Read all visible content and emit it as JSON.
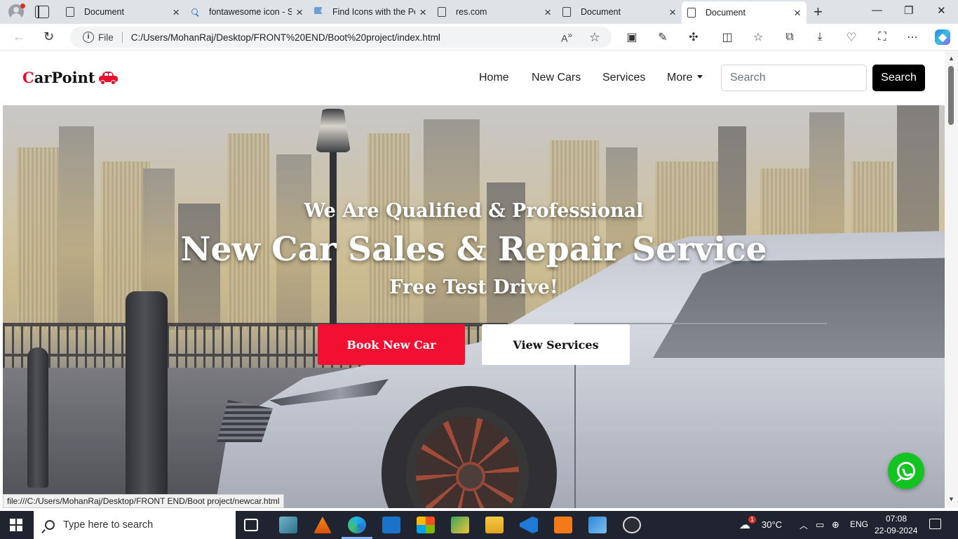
{
  "browser": {
    "tabs": [
      {
        "label": "Document",
        "icon": "page-icon"
      },
      {
        "label": "fontawesome icon - S",
        "icon": "search-icon"
      },
      {
        "label": "Find Icons with the Pe",
        "icon": "flag-icon"
      },
      {
        "label": "res.com",
        "icon": "page-icon"
      },
      {
        "label": "Document",
        "icon": "page-icon"
      },
      {
        "label": "Document",
        "icon": "page-icon",
        "active": true
      }
    ],
    "new_tab": "+",
    "minimize": "—",
    "restore": "❐",
    "close": "✕",
    "address": {
      "scheme_label": "File",
      "url": "C:/Users/MohanRaj/Desktop/FRONT%20END/Boot%20project/index.html"
    },
    "status_url": "file:///C:/Users/MohanRaj/Desktop/FRONT END/Boot project/newcar.html"
  },
  "site": {
    "brand": {
      "first": "C",
      "rest": "arPoint"
    },
    "nav": {
      "home": "Home",
      "new_cars": "New Cars",
      "services": "Services",
      "more": "More"
    },
    "search": {
      "placeholder": "Search",
      "button": "Search"
    },
    "hero": {
      "tagline": "We Are Qualified & Professional",
      "headline": "New Car Sales & Repair Service",
      "subline": "Free Test Drive!",
      "cta_primary": "Book New Car",
      "cta_secondary": "View Services"
    },
    "colors": {
      "accent": "#f20f32",
      "whatsapp": "#12c322"
    }
  },
  "taskbar": {
    "search_placeholder": "Type here to search",
    "weather_badge": "1",
    "temperature": "30°C",
    "language": "ENG",
    "time": "07:08",
    "date": "22-09-2024"
  }
}
